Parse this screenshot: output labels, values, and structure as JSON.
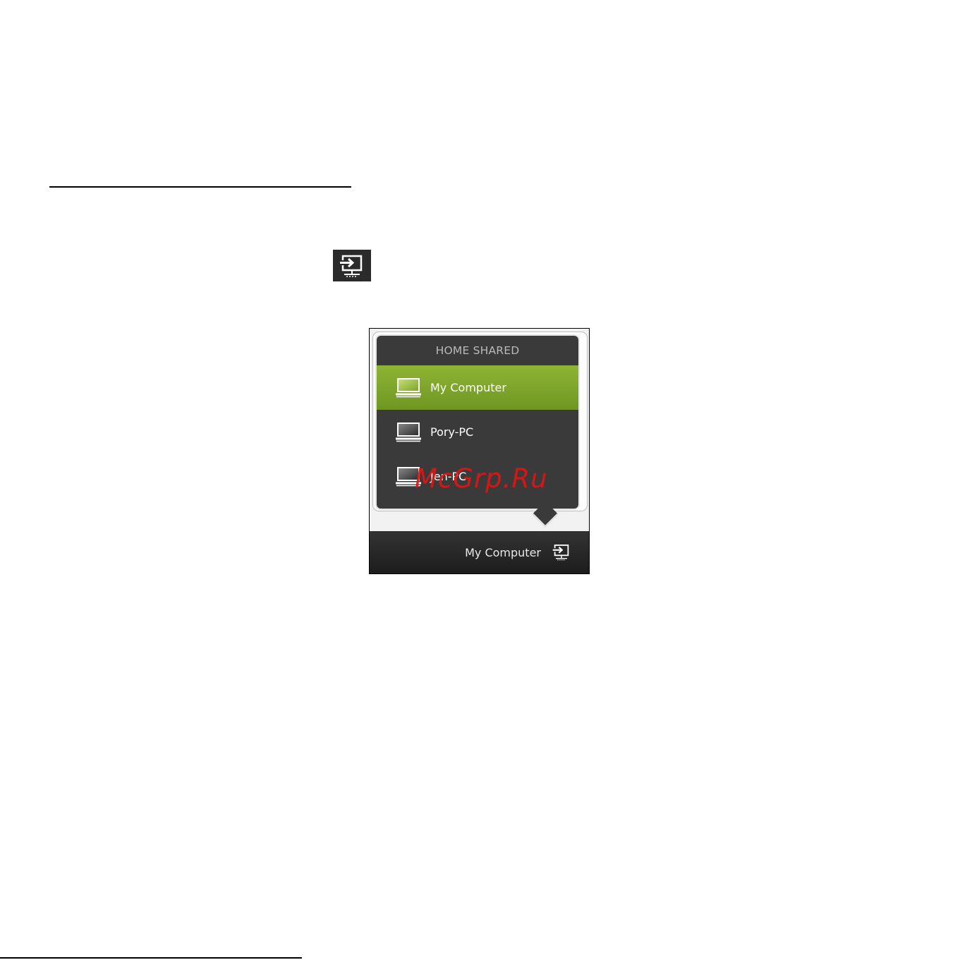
{
  "inline_icon": {
    "name": "display-switch-icon"
  },
  "popup": {
    "header": "HOME SHARED",
    "devices": [
      {
        "label": "My Computer",
        "selected": true
      },
      {
        "label": "Pory-PC",
        "selected": false
      },
      {
        "label": "Jen-PC",
        "selected": false
      }
    ]
  },
  "taskbar": {
    "label": "My Computer",
    "icon": "display-switch-icon"
  },
  "watermark": "McGrp.Ru",
  "colors": {
    "selected_row": "#7ea42b",
    "popup_bg": "#3a3a3a",
    "taskbar_bg": "#262626",
    "watermark": "#e01515"
  }
}
